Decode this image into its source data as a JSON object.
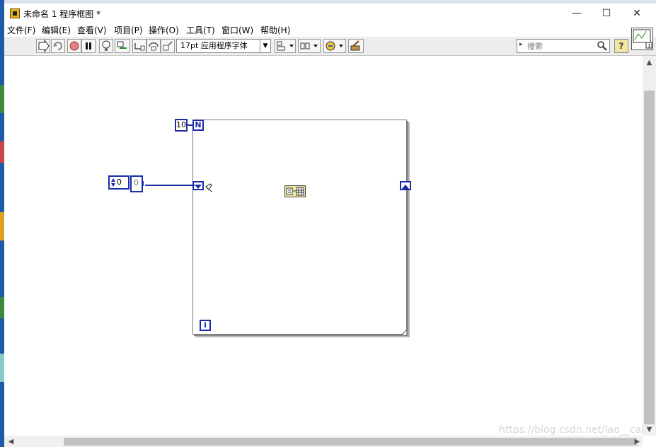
{
  "window": {
    "title": "未命名 1 程序框图 *",
    "minimize_glyph": "—",
    "maximize_glyph": "☐",
    "close_glyph": "✕"
  },
  "menu": [
    {
      "label": "文件(F)"
    },
    {
      "label": "编辑(E)"
    },
    {
      "label": "查看(V)"
    },
    {
      "label": "项目(P)"
    },
    {
      "label": "操作(O)"
    },
    {
      "label": "工具(T)"
    },
    {
      "label": "窗口(W)"
    },
    {
      "label": "帮助(H)"
    }
  ],
  "toolbar": {
    "font_selector": "17pt 应用程序字体",
    "search_placeholder": "搜索",
    "help_label": "?",
    "icons": [
      "run-arrow-icon",
      "retain-wire-values-icon",
      "abort-icon",
      "pause-icon",
      "highlight-execution-icon",
      "probe-icon",
      "step-into-icon",
      "step-over-icon",
      "step-out-icon",
      "align-icon",
      "distribute-icon",
      "reorder-icon",
      "cleanup-diagram-icon"
    ]
  },
  "diagram": {
    "loop_count": "10",
    "count_terminal": "N",
    "iteration_terminal": "i",
    "numeric_control_value": "0",
    "numeric_indicator_value": "0"
  },
  "watermark": "https://blog.csdn.net/lao__cai",
  "colors": {
    "wire_blue": "#1b2ca8",
    "window_bg": "#ffffff",
    "toolbar_bg": "#ededed"
  }
}
